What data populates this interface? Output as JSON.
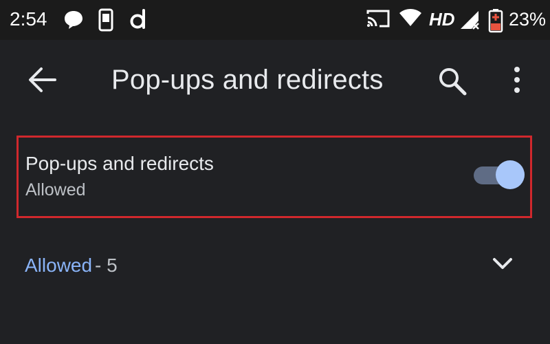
{
  "status_bar": {
    "time": "2:54",
    "network": "HD",
    "battery_percent": "23%",
    "icons": [
      "chat-bubble-icon",
      "phone-device-icon",
      "d-app-icon",
      "cast-icon",
      "wifi-icon",
      "signal-icon",
      "battery-icon"
    ]
  },
  "app_bar": {
    "title": "Pop-ups and redirects",
    "back_icon": "arrow-left-icon",
    "search_icon": "search-icon",
    "more_icon": "more-vertical-icon"
  },
  "setting": {
    "title": "Pop-ups and redirects",
    "subtitle": "Allowed",
    "enabled": true,
    "highlight_color": "#d0282d"
  },
  "allowed_section": {
    "label": "Allowed",
    "count_text": " - 5",
    "expand_icon": "chevron-down-icon"
  },
  "colors": {
    "background": "#202124",
    "accent": "#8ab4f8",
    "toggle_thumb": "#a8c7fa",
    "toggle_track": "#5f6c85"
  }
}
